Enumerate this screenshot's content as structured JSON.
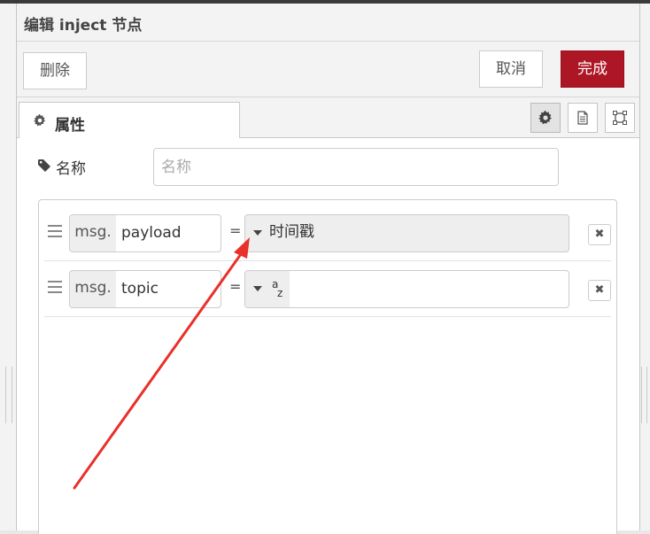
{
  "dialog": {
    "title": "编辑 inject 节点"
  },
  "toolbar": {
    "delete_label": "删除",
    "cancel_label": "取消",
    "done_label": "完成"
  },
  "tabs": {
    "properties_label": "属性",
    "icons": [
      "gear-icon",
      "description-icon",
      "appearance-icon"
    ]
  },
  "name": {
    "label": "名称",
    "placeholder": "名称",
    "value": ""
  },
  "rows": [
    {
      "prefix": "msg.",
      "field": "payload",
      "operator": "=",
      "type_label": "时间戳"
    },
    {
      "prefix": "msg.",
      "field": "topic",
      "operator": "=",
      "type_a": "a",
      "type_z": "z",
      "value": ""
    }
  ],
  "colors": {
    "primary": "#ad1625",
    "annotation": "#e8312a"
  }
}
